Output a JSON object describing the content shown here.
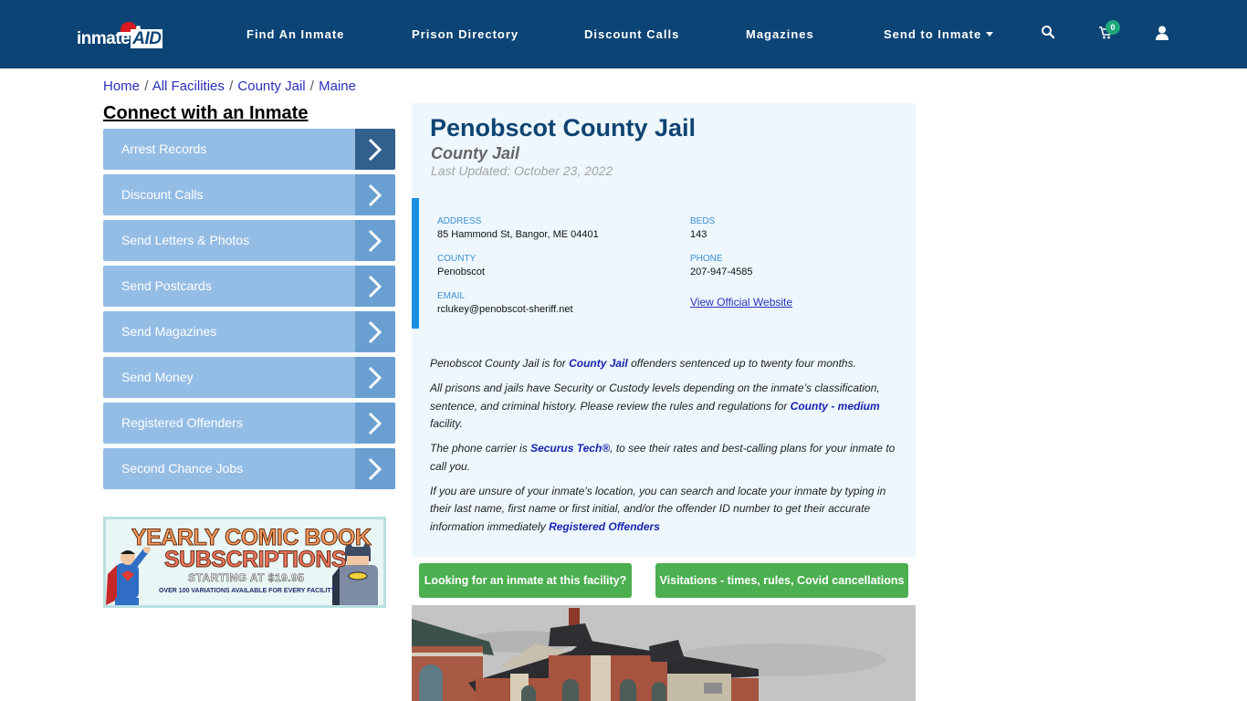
{
  "header": {
    "logo": {
      "text_main": "inmate",
      "text_accent": "AID"
    },
    "nav": [
      {
        "label": "Find An Inmate"
      },
      {
        "label": "Prison Directory"
      },
      {
        "label": "Discount Calls"
      },
      {
        "label": "Magazines"
      },
      {
        "label": "Send to Inmate",
        "has_dropdown": true
      }
    ],
    "icons": {
      "search": "search-icon",
      "cart": "cart-icon",
      "user": "user-icon"
    },
    "cart_count": "0"
  },
  "breadcrumb": [
    {
      "label": "Home"
    },
    {
      "label": "All Facilities"
    },
    {
      "label": "County Jail"
    },
    {
      "label": "Maine"
    }
  ],
  "sidebar": {
    "title": "Connect with an Inmate",
    "items": [
      {
        "label": "Arrest Records",
        "active": true
      },
      {
        "label": "Discount Calls"
      },
      {
        "label": "Send Letters & Photos"
      },
      {
        "label": "Send Postcards"
      },
      {
        "label": "Send Magazines"
      },
      {
        "label": "Send Money"
      },
      {
        "label": "Registered Offenders"
      },
      {
        "label": "Second Chance Jobs"
      }
    ],
    "banner": {
      "line1": "YEARLY COMIC BOOK",
      "line2": "SUBSCRIPTIONS",
      "line3": "STARTING AT $19.95",
      "line4": "OVER 100 VARIATIONS AVAILABLE FOR EVERY FACILITY"
    }
  },
  "facility": {
    "name": "Penobscot County Jail",
    "type": "County Jail",
    "last_updated": "Last Updated: October 23, 2022",
    "fields": {
      "address": {
        "label": "ADDRESS",
        "value": "85 Hammond St, Bangor, ME 04401"
      },
      "county": {
        "label": "COUNTY",
        "value": "Penobscot"
      },
      "email": {
        "label": "EMAIL",
        "value": "rclukey@penobscot-sheriff.net"
      },
      "beds": {
        "label": "BEDS",
        "value": "143"
      },
      "phone": {
        "label": "PHONE",
        "value": "207-947-4585"
      },
      "website_link": "View Official Website"
    },
    "description": {
      "p1": {
        "pre": "Penobscot County Jail is for ",
        "link": "County Jail",
        "post": " offenders sentenced up to twenty four months."
      },
      "p2": {
        "pre": "All prisons and jails have Security or Custody levels depending on the inmate’s classification, sentence, and criminal history. Please review the rules and regulations for ",
        "link": "County - medium",
        "post": " facility."
      },
      "p3": {
        "pre": "The phone carrier is ",
        "link": "Securus Tech®",
        "post": ", to see their rates and best-calling plans for your inmate to call you."
      },
      "p4": {
        "pre": "If you are unsure of your inmate's location, you can search and locate your inmate by typing in their last name, first name or first initial, and/or the offender ID number to get their accurate information immediately ",
        "link": "Registered Offenders",
        "post": ""
      }
    },
    "buttons": {
      "find_inmate": "Looking for an inmate at this facility?",
      "visitations": "Visitations - times, rules, Covid cancellations"
    }
  },
  "colors": {
    "header_bg": "#0c4475",
    "sidebar_item": "#94bde6",
    "sidebar_arrow": "#6a9fd1",
    "sidebar_arrow_active": "#31608d",
    "panel_bg": "#edf7fd",
    "accent_blue": "#1a8fe3",
    "button_green": "#4caf50",
    "link": "#2a2fb8"
  }
}
